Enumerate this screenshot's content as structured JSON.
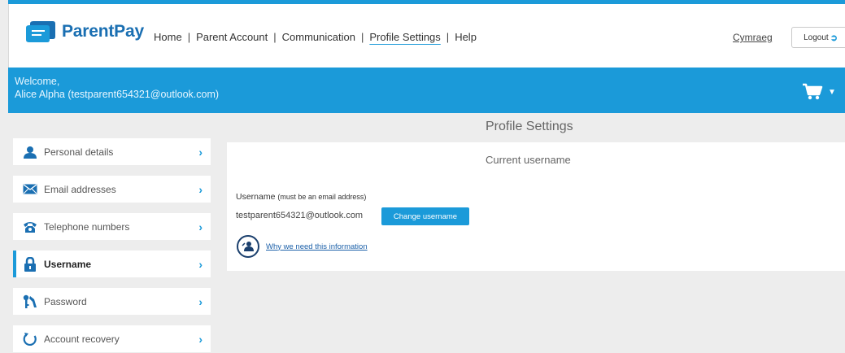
{
  "header": {
    "brand": "ParentPay",
    "nav": [
      {
        "label": "Home",
        "active": false
      },
      {
        "label": "Parent Account",
        "active": false
      },
      {
        "label": "Communication",
        "active": false
      },
      {
        "label": "Profile Settings",
        "active": true
      },
      {
        "label": "Help",
        "active": false
      }
    ],
    "nav_separator": "|",
    "language_link": "Cymraeg",
    "logout_label": "Logout"
  },
  "banner": {
    "welcome_line1": "Welcome,",
    "welcome_line2": "Alice Alpha (testparent654321@outlook.com)",
    "cart_icon": "shopping-cart-icon"
  },
  "page": {
    "title": "Profile Settings"
  },
  "sidebar": {
    "items": [
      {
        "label": "Personal details",
        "icon": "person-icon",
        "active": false
      },
      {
        "label": "Email addresses",
        "icon": "envelope-icon",
        "active": false
      },
      {
        "label": "Telephone numbers",
        "icon": "telephone-icon",
        "active": false
      },
      {
        "label": "Username",
        "icon": "padlock-icon",
        "active": true
      },
      {
        "label": "Password",
        "icon": "keys-icon",
        "active": false
      },
      {
        "label": "Account recovery",
        "icon": "refresh-icon",
        "active": false
      }
    ]
  },
  "panel": {
    "title": "Current username",
    "username_label": "Username",
    "username_hint": "(must be an email address)",
    "username_value": "testparent654321@outlook.com",
    "change_button": "Change username",
    "why_link": "Why we need this information"
  },
  "colors": {
    "accent": "#1b9ad9",
    "brand": "#1a6fb2",
    "background": "#ededed"
  }
}
